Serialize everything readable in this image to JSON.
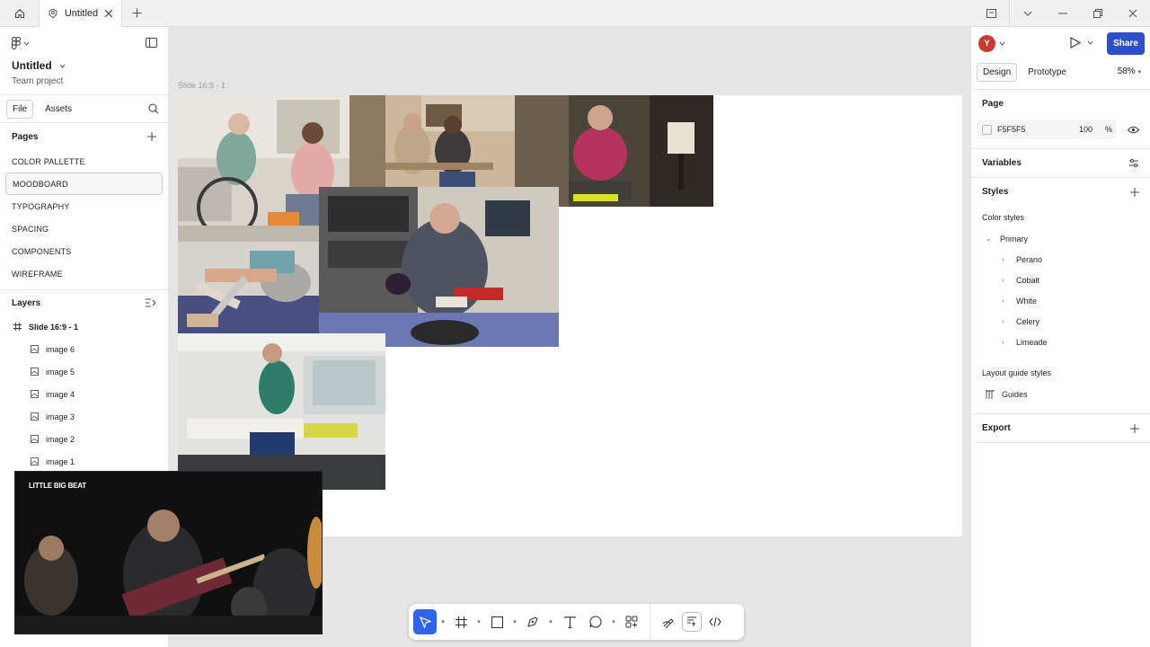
{
  "titlebar": {
    "tab_title": "Untitled"
  },
  "file": {
    "name": "Untitled",
    "team": "Team project"
  },
  "left_tabs": {
    "file": "File",
    "assets": "Assets"
  },
  "pages": {
    "header": "Pages",
    "items": [
      "COLOR PALLETTE",
      "MOODBOARD",
      "TYPOGRAPHY",
      "SPACING",
      "COMPONENTS",
      "WIREFRAME"
    ],
    "selected": "MOODBOARD"
  },
  "layers": {
    "header": "Layers",
    "frame": "Slide 16:9 - 1",
    "items": [
      "image 6",
      "image 5",
      "image 4",
      "image 3",
      "image 2",
      "image 1"
    ]
  },
  "canvas": {
    "frame_label": "Slide 16:9 - 1",
    "background": "#e5e5e5"
  },
  "video": {
    "title": "LITTLE BIG BEAT"
  },
  "right": {
    "avatar_letter": "Y",
    "share_label": "Share",
    "tab_design": "Design",
    "tab_prototype": "Prototype",
    "zoom": "58%",
    "page_header": "Page",
    "page_color": "F5F5F5",
    "page_opacity": "100",
    "page_opacity_unit": "%",
    "variables_header": "Variables",
    "styles_header": "Styles",
    "color_styles_label": "Color styles",
    "color_group": "Primary",
    "color_items": [
      "Perano",
      "Cobalt",
      "White",
      "Celery",
      "Limeade"
    ],
    "layout_guide_label": "Layout guide styles",
    "guides_label": "Guides",
    "export_header": "Export"
  },
  "help_label": "?",
  "colors": {
    "accent": "#2f64f1",
    "share": "#2f4fc6",
    "avatar": "#c83a2e"
  }
}
